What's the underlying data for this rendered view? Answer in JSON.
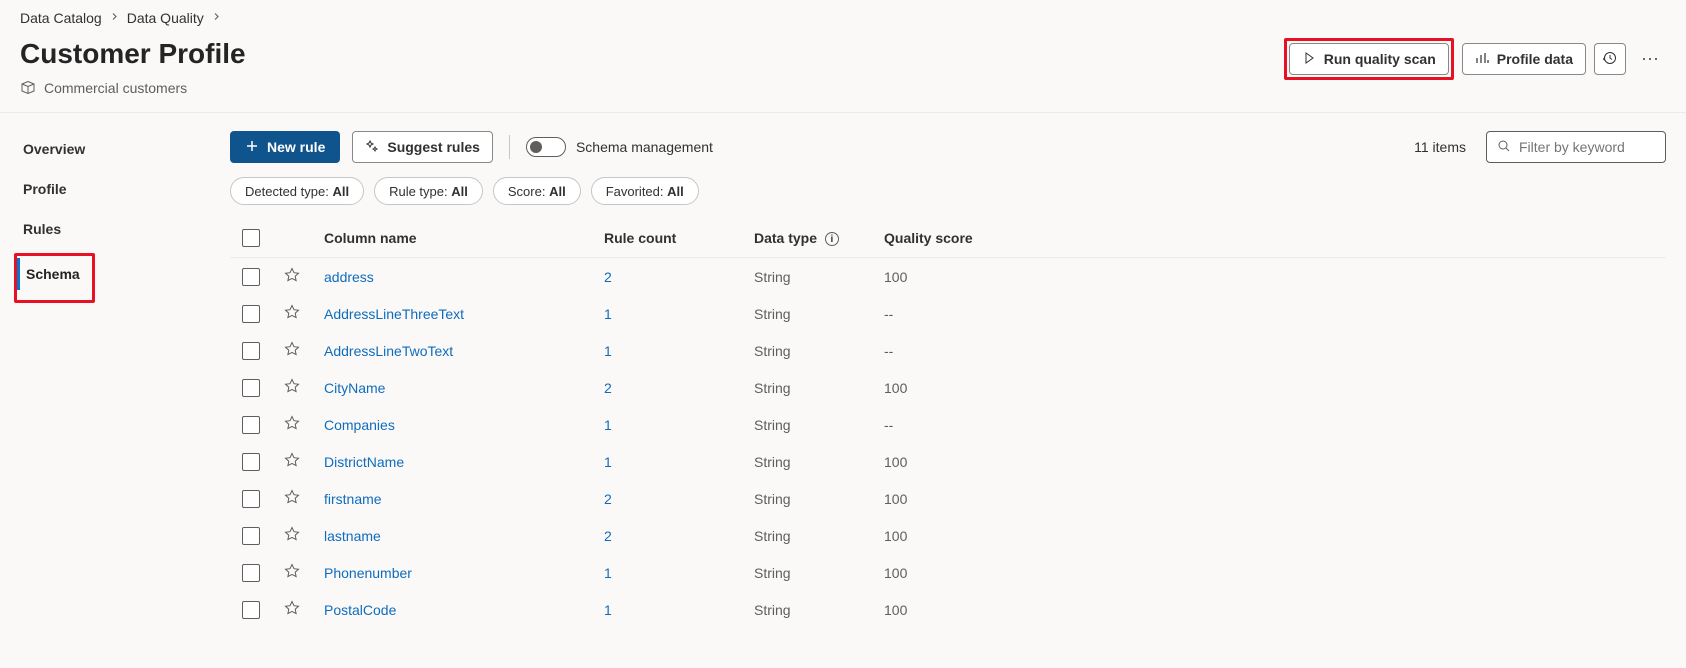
{
  "breadcrumb": {
    "items": [
      "Data Catalog",
      "Data Quality"
    ]
  },
  "header": {
    "title": "Customer Profile",
    "subtitle": "Commercial customers",
    "run_scan": "Run quality scan",
    "profile_data": "Profile data"
  },
  "nav": {
    "items": [
      {
        "label": "Overview",
        "active": false
      },
      {
        "label": "Profile",
        "active": false
      },
      {
        "label": "Rules",
        "active": false
      },
      {
        "label": "Schema",
        "active": true
      }
    ]
  },
  "toolbar": {
    "new_rule": "New rule",
    "suggest_rules": "Suggest rules",
    "schema_mgmt": "Schema management",
    "item_count": "11 items",
    "filter_placeholder": "Filter by keyword"
  },
  "filters": [
    {
      "label": "Detected type:",
      "value": "All"
    },
    {
      "label": "Rule type:",
      "value": "All"
    },
    {
      "label": "Score:",
      "value": "All"
    },
    {
      "label": "Favorited:",
      "value": "All"
    }
  ],
  "table": {
    "headers": {
      "column_name": "Column name",
      "rule_count": "Rule count",
      "data_type": "Data type",
      "quality_score": "Quality score"
    },
    "rows": [
      {
        "name": "address",
        "rule_count": "2",
        "data_type": "String",
        "quality_score": "100"
      },
      {
        "name": "AddressLineThreeText",
        "rule_count": "1",
        "data_type": "String",
        "quality_score": "--"
      },
      {
        "name": "AddressLineTwoText",
        "rule_count": "1",
        "data_type": "String",
        "quality_score": "--"
      },
      {
        "name": "CityName",
        "rule_count": "2",
        "data_type": "String",
        "quality_score": "100"
      },
      {
        "name": "Companies",
        "rule_count": "1",
        "data_type": "String",
        "quality_score": "--"
      },
      {
        "name": "DistrictName",
        "rule_count": "1",
        "data_type": "String",
        "quality_score": "100"
      },
      {
        "name": "firstname",
        "rule_count": "2",
        "data_type": "String",
        "quality_score": "100"
      },
      {
        "name": "lastname",
        "rule_count": "2",
        "data_type": "String",
        "quality_score": "100"
      },
      {
        "name": "Phonenumber",
        "rule_count": "1",
        "data_type": "String",
        "quality_score": "100"
      },
      {
        "name": "PostalCode",
        "rule_count": "1",
        "data_type": "String",
        "quality_score": "100"
      }
    ]
  }
}
